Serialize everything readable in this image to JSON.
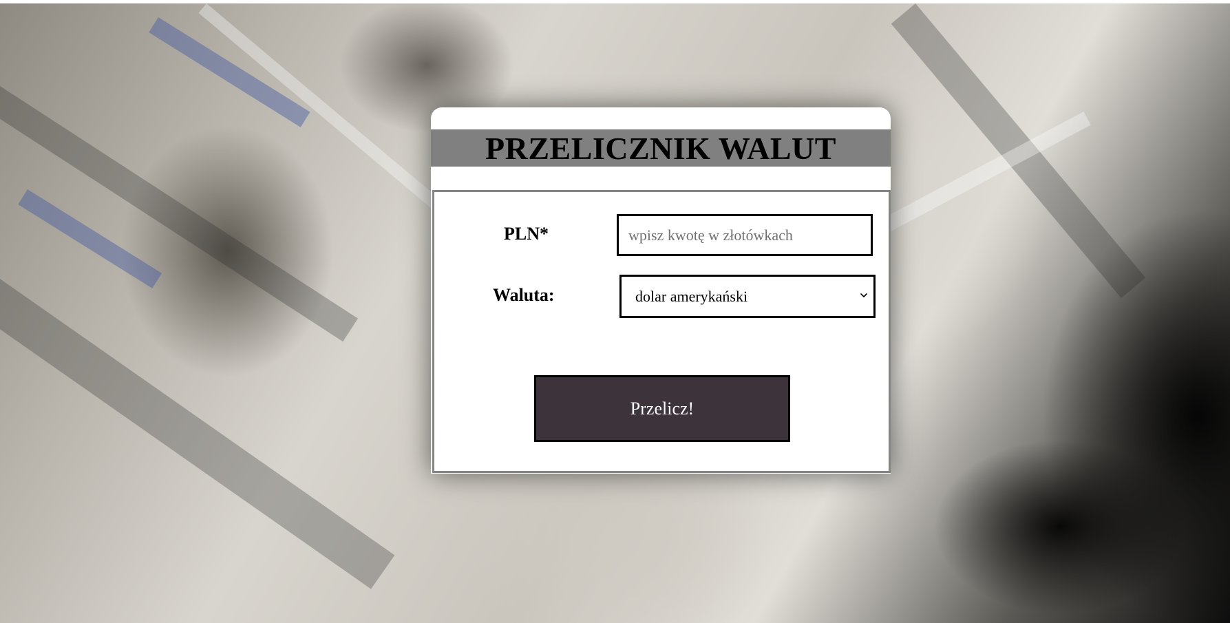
{
  "page": {
    "title": "PRZELICZNIK WALUT"
  },
  "form": {
    "pln_label": "PLN*",
    "pln_placeholder": "wpisz kwotę w złotówkach",
    "pln_value": "",
    "currency_label": "Waluta:",
    "currency_selected": "dolar amerykański",
    "convert_label": "Przelicz!"
  },
  "icons": {
    "select": "chevron-down-icon"
  },
  "colors": {
    "title_bar": "#808080",
    "button_bg": "#3d333a",
    "button_text": "#ffffff",
    "form_border": "#858585"
  }
}
